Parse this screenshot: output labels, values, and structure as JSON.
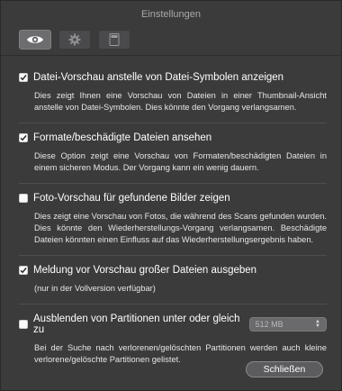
{
  "window": {
    "title": "Einstellungen"
  },
  "toolbar": {
    "tabs": [
      {
        "icon": "eye-icon",
        "active": true
      },
      {
        "icon": "gear-icon",
        "active": false
      },
      {
        "icon": "drive-icon",
        "active": false
      }
    ]
  },
  "options": [
    {
      "checked": true,
      "label": "Datei-Vorschau anstelle von Datei-Symbolen anzeigen",
      "description": "Dies zeigt Ihnen eine Vorschau von Dateien in einer Thumbnail-Ansicht anstelle von Datei-Symbolen. Dies könnte den Vorgang verlangsamen."
    },
    {
      "checked": true,
      "label": "Formate/beschädigte Dateien ansehen",
      "description": "Diese Option zeigt eine Vorschau von Formaten/beschädigten Dateien in einem sicheren Modus. Der Vorgang kann ein wenig dauern."
    },
    {
      "checked": false,
      "label": "Foto-Vorschau für gefundene Bilder zeigen",
      "description": "Dies zeigt eine Vorschau von Fotos, die während des Scans gefunden wurden. Dies könnte den Wiederherstellungs-Vorgang verlangsamen. Beschädigte Dateien könnten einen Einfluss auf das Wiederherstellungsergebnis haben."
    },
    {
      "checked": true,
      "label": "Meldung vor Vorschau großer Dateien ausgeben",
      "description": "(nur in der Vollversion verfügbar)"
    },
    {
      "checked": false,
      "label": "Ausblenden von Partitionen unter oder gleich zu",
      "description": "Bei der Suche nach verlorenen/gelöschten Partitionen werden auch kleine verlorene/gelöschte Partitionen gelistet.",
      "select_value": "512 MB"
    }
  ],
  "footer": {
    "close_label": "Schließen"
  },
  "colors": {
    "background": "#3b3b3c",
    "text": "#ffffff",
    "muted": "#a9a9aa"
  }
}
